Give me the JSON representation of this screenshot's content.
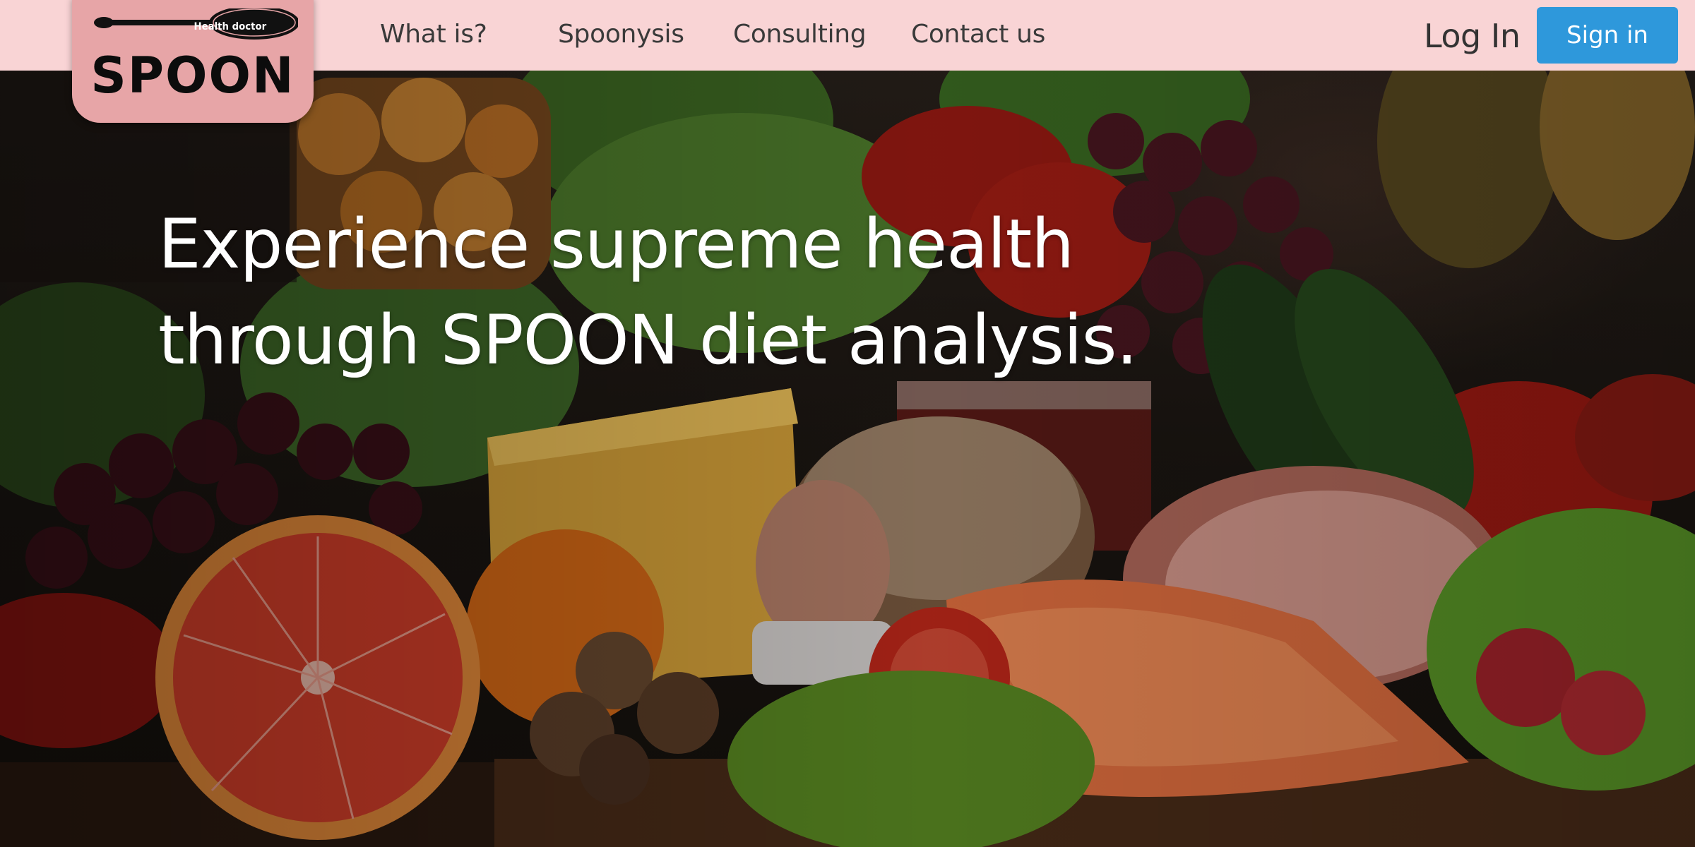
{
  "brand": {
    "name": "SPOON",
    "tagline": "Health doctor"
  },
  "nav": {
    "links": [
      "What is?",
      "Spoonysis",
      "Consulting",
      "Contact us"
    ],
    "login_label": "Log In",
    "signin_label": "Sign in"
  },
  "hero": {
    "headline_line1": "Experience supreme health",
    "headline_line2": "through SPOON diet analysis.",
    "background_image": "food-assortment-photo"
  },
  "colors": {
    "navbar_bg": "#f9d4d5",
    "logo_bg": "#e7a5a7",
    "signin_bg": "#2e98db",
    "headline_text": "#ffffff"
  }
}
